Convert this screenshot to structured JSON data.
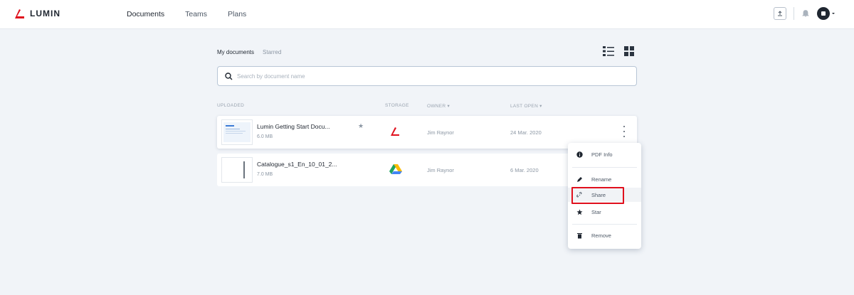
{
  "app": {
    "logo_text": "LUMIN",
    "nav": [
      "Documents",
      "Teams",
      "Plans"
    ]
  },
  "tabs": [
    "My documents",
    "Starred"
  ],
  "search": {
    "placeholder": "Search by document name"
  },
  "columns": {
    "uploaded": "UPLOADED",
    "storage": "STORAGE",
    "owner": "OWNER",
    "last_open": "LAST OPEN"
  },
  "documents": [
    {
      "name": "Lumin Getting Start Docu...",
      "size": "6.0 MB",
      "storage_icon": "lumin-logo-icon",
      "owner": "Jim Raynor",
      "last_open": "24 Mar. 2020",
      "starred": false
    },
    {
      "name": "Catalogue_s1_En_10_01_2...",
      "size": "7.0 MB",
      "storage_icon": "google-drive-icon",
      "owner": "Jim Raynor",
      "last_open": "6 Mar. 2020",
      "starred": false
    }
  ],
  "context_menu": {
    "items": [
      {
        "label": "PDF Info",
        "icon": "info-icon"
      },
      {
        "label": "Rename",
        "icon": "pencil-icon"
      },
      {
        "label": "Share",
        "icon": "link-icon"
      },
      {
        "label": "Star",
        "icon": "star-icon"
      },
      {
        "label": "Remove",
        "icon": "trash-icon"
      }
    ]
  },
  "colors": {
    "brand_red": "#e0101d",
    "background": "#f1f4f8",
    "highlight_box": "#e0101d"
  }
}
